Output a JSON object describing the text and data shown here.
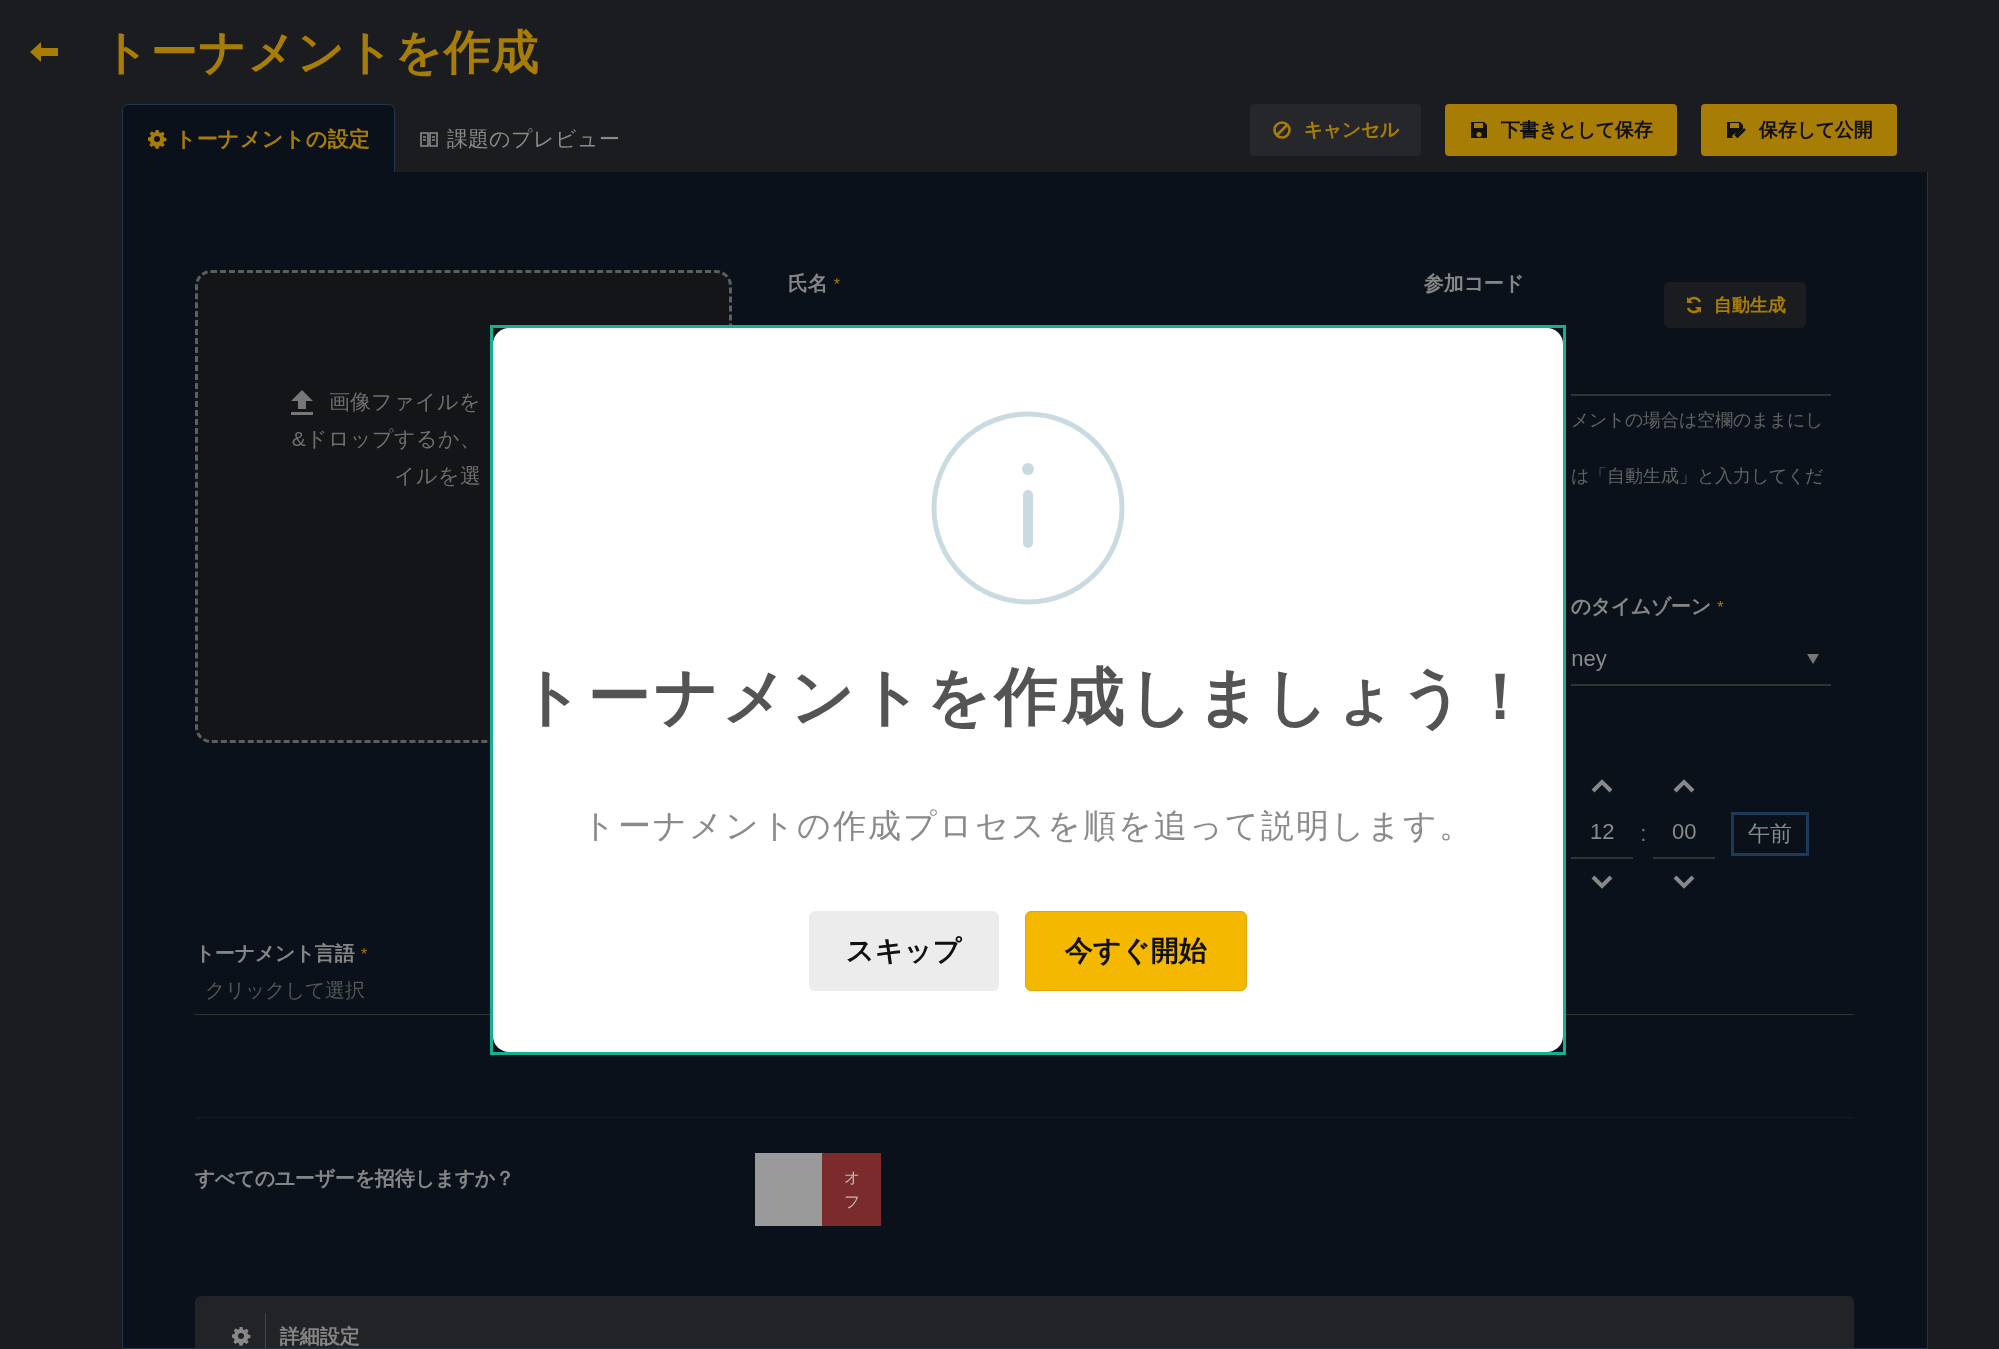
{
  "header": {
    "title": "トーナメントを作成"
  },
  "tabs": [
    {
      "label": "トーナメントの設定",
      "selected": true
    },
    {
      "label": "課題のプレビュー",
      "selected": false
    }
  ],
  "actions": [
    {
      "label": "キャンセル",
      "kind": "secondary"
    },
    {
      "label": "下書きとして保存",
      "kind": "primary"
    },
    {
      "label": "保存して公開",
      "kind": "primary"
    }
  ],
  "upload": {
    "lines": [
      "画像ファイルを",
      "&ドロップするか、",
      "イルを選"
    ]
  },
  "name_field": {
    "label": "氏名",
    "mark": "*"
  },
  "code_field": {
    "label": "参加コード",
    "button": "自動生成",
    "help": [
      "メントの場合は空欄のままにし",
      "は「自動生成」と入力してくだ"
    ]
  },
  "timezone_field": {
    "label": "のタイムゾーン",
    "mark": "*",
    "value": "ney"
  },
  "time_picker": {
    "hour": "12",
    "separator": ":",
    "minute": "00",
    "period": "午前"
  },
  "language_field": {
    "label": "トーナメント言語",
    "mark": "*",
    "placeholder": "クリックして選択"
  },
  "invite_all": {
    "label": "すべてのユーザーを招待しますか？",
    "on": false,
    "toggle_text": "オフ"
  },
  "advanced": {
    "label": "詳細設定"
  },
  "modal": {
    "title": "トーナメントを作成しましょう！",
    "message": "トーナメントの作成プロセスを順を追って説明します。",
    "buttons": [
      {
        "label": "スキップ",
        "kind": "secondary"
      },
      {
        "label": "今すぐ開始",
        "kind": "primary"
      }
    ]
  }
}
